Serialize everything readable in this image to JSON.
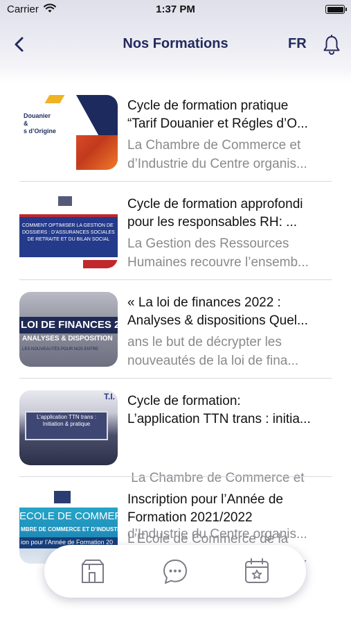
{
  "status_bar": {
    "carrier": "Carrier",
    "time": "1:37 PM"
  },
  "nav": {
    "title": "Nos Formations",
    "language": "FR",
    "back_icon": "chevron-left-icon",
    "bell_icon": "bell-icon"
  },
  "colors": {
    "accent": "#232a5c",
    "secondary_text": "#8a8a8e",
    "divider": "#d9d9de"
  },
  "formations": [
    {
      "title_line1": "Cycle de formation pratique",
      "title_line2": "“Tarif Douanier et Régles d’O...",
      "desc_line1": "La Chambre de Commerce et",
      "desc_line2": "d’Industrie du Centre organis...",
      "thumb": {
        "line1": "Douanier",
        "line2": "&",
        "line3": "s d’Origine"
      }
    },
    {
      "title_line1": "Cycle de formation approfondi",
      "title_line2": "pour les responsables RH: ...",
      "desc_line1": "La Gestion des Ressources",
      "desc_line2": "Humaines recouvre l’ensemb...",
      "thumb": {
        "line1": "COMMENT OPTIMISER LA GESTION DE VOS",
        "line2": "DOSSIERS : D’ASSURANCES SOCIALES,",
        "line3": "DE RETRAITE ET DU BILAN SOCIAL"
      }
    },
    {
      "title_line1": "« La loi de finances 2022 :",
      "title_line2": "Analyses & dispositions Quel...",
      "desc_line1": "ans le but de décrypter les",
      "desc_line2": "nouveautés de la loi de fina...",
      "thumb": {
        "line1": "LOI DE FINANCES 2",
        "line2": "ANALYSES & DISPOSITION",
        "line3": "LES NOUVEAUTÉS POUR NOS ENTRE"
      }
    },
    {
      "title_line1": "Cycle de formation:",
      "title_line2": "L’application TTN trans : initia...",
      "desc_line1": " La Chambre de Commerce et",
      "desc_line2": "d’Industrie du Centre organis...",
      "thumb": {
        "line1": "L’application TTN trans :",
        "line2": "Initiation & pratique",
        "line3": "T.I."
      }
    },
    {
      "title_line1": "Inscription pour l’Année de",
      "title_line2": "Formation 2021/2022",
      "desc_line1": "L’Ecole de Commerce de la",
      "desc_line2": "Chambre de Commerce et d’...",
      "thumb": {
        "line1": "ECOLE DE COMMERCE",
        "line2": "MBRE DE COMMERCE ET D’INDUSTRIE DU C",
        "line3": "ion pour l’Année de Formation 20"
      }
    }
  ],
  "tab_bar": {
    "items": [
      {
        "icon": "store-icon"
      },
      {
        "icon": "chat-bubble-icon"
      },
      {
        "icon": "calendar-star-icon"
      }
    ]
  }
}
